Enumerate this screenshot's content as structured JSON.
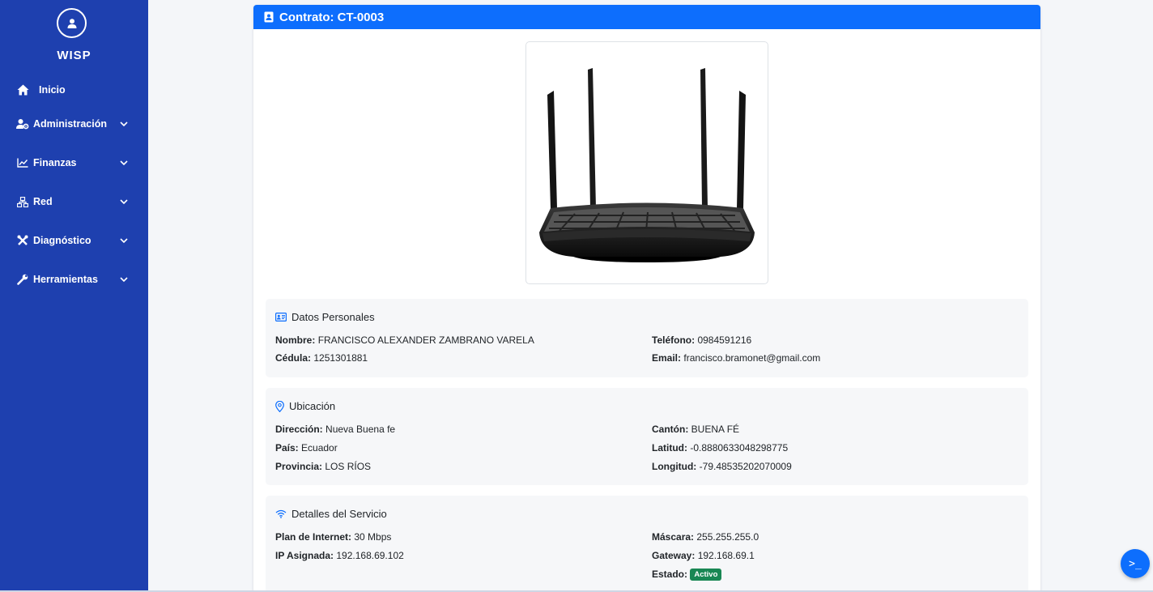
{
  "sidebar": {
    "brand": "WISP",
    "avatar_icon": "user-circle-icon",
    "items": [
      {
        "label": "Inicio",
        "icon": "home-icon"
      },
      {
        "label": "Administración",
        "icon": "user-cog-icon"
      },
      {
        "label": "Finanzas",
        "icon": "chart-line-icon"
      },
      {
        "label": "Red",
        "icon": "network-icon"
      },
      {
        "label": "Diagnóstico",
        "icon": "tools-icon"
      },
      {
        "label": "Herramientas",
        "icon": "wrench-icon"
      }
    ]
  },
  "contract": {
    "title": "Contrato: CT-0003",
    "image_icon": "router-image"
  },
  "personal": {
    "title": "Datos Personales",
    "nombre_label": "Nombre:",
    "nombre": "FRANCISCO ALEXANDER ZAMBRANO VARELA",
    "cedula_label": "Cédula:",
    "cedula": "1251301881",
    "telefono_label": "Teléfono:",
    "telefono": "0984591216",
    "email_label": "Email:",
    "email": "francisco.bramonet@gmail.com"
  },
  "ubicacion": {
    "title": "Ubicación",
    "direccion_label": "Dirección:",
    "direccion": "Nueva Buena fe",
    "pais_label": "País:",
    "pais": "Ecuador",
    "provincia_label": "Provincia:",
    "provincia": "LOS RÍOS",
    "canton_label": "Cantón:",
    "canton": "BUENA FÉ",
    "latitud_label": "Latitud:",
    "latitud": "-0.8880633048298775",
    "longitud_label": "Longitud:",
    "longitud": "-79.48535202070009"
  },
  "servicio": {
    "title": "Detalles del Servicio",
    "plan_label": "Plan de Internet:",
    "plan": "30 Mbps",
    "ip_label": "IP Asignada:",
    "ip": "192.168.69.102",
    "mascara_label": "Máscara:",
    "mascara": "255.255.255.0",
    "gateway_label": "Gateway:",
    "gateway": "192.168.69.1",
    "estado_label": "Estado:",
    "estado": "Activo"
  },
  "fab": {
    "label": ">_",
    "icon": "terminal-icon"
  },
  "colors": {
    "sidebar": "#1e40af",
    "primary": "#0d6efd",
    "success": "#198754"
  }
}
